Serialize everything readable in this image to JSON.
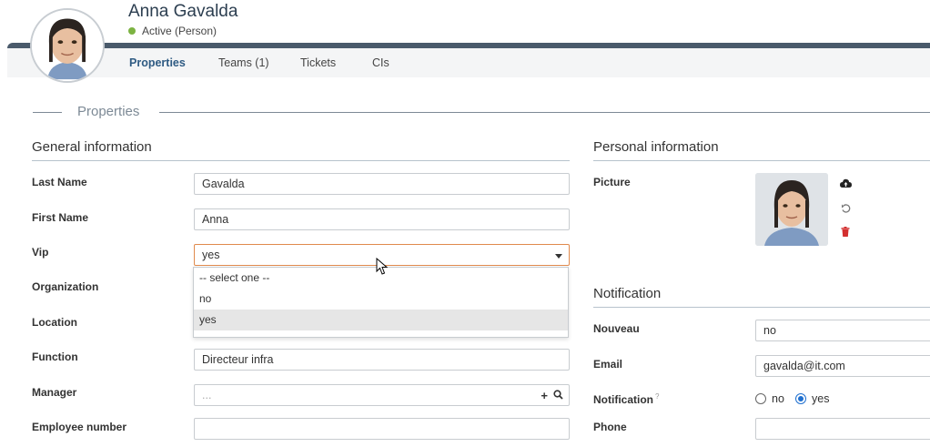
{
  "header": {
    "name": "Anna Gavalda",
    "status": "Active (Person)",
    "status_color": "#7cb342"
  },
  "tabs": [
    {
      "label": "Properties",
      "active": true
    },
    {
      "label": "Teams (1)",
      "active": false
    },
    {
      "label": "Tickets",
      "active": false
    },
    {
      "label": "CIs",
      "active": false
    }
  ],
  "properties_legend": "Properties",
  "general": {
    "title": "General information",
    "last_name": {
      "label": "Last Name",
      "value": "Gavalda"
    },
    "first_name": {
      "label": "First Name",
      "value": "Anna"
    },
    "vip": {
      "label": "Vip",
      "value": "yes",
      "options": [
        "-- select one --",
        "no",
        "yes"
      ]
    },
    "organization": {
      "label": "Organization"
    },
    "location": {
      "label": "Location"
    },
    "function": {
      "label": "Function",
      "value": "Directeur infra"
    },
    "manager": {
      "label": "Manager",
      "placeholder": "...",
      "icons": [
        "plus-icon",
        "search-icon"
      ]
    },
    "employee_number": {
      "label": "Employee number",
      "value": ""
    }
  },
  "personal": {
    "title": "Personal information",
    "picture_label": "Picture",
    "picture_actions": [
      "upload-icon",
      "undo-icon",
      "trash-icon"
    ]
  },
  "notification_section": {
    "title": "Notification",
    "nouveau": {
      "label": "Nouveau",
      "value": "no"
    },
    "email": {
      "label": "Email",
      "value": "gavalda@it.com"
    },
    "notification": {
      "label": "Notification",
      "hint": "?",
      "options": [
        "no",
        "yes"
      ],
      "selected": "yes"
    },
    "phone": {
      "label": "Phone",
      "value": ""
    }
  },
  "colors": {
    "accent": "#2f5b83",
    "header_bar": "#4a5a6b",
    "radio_selected": "#1f6fcf",
    "focus_border": "#e08a4d",
    "delete": "#d32f2f"
  }
}
